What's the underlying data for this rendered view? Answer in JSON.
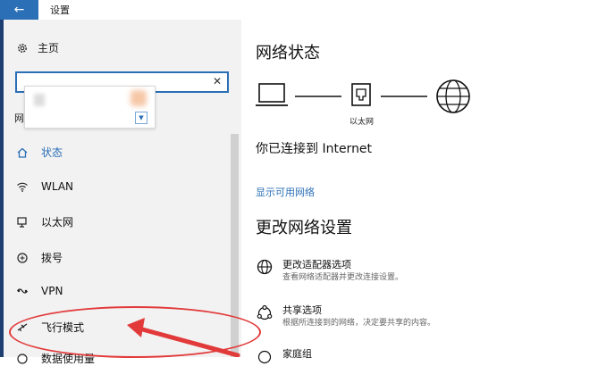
{
  "titlebar": {
    "title": "设置",
    "back_glyph": "←"
  },
  "sidebar": {
    "home_label": "主页",
    "search_value": "",
    "clear_glyph": "✕",
    "cut_label": "网",
    "items": [
      {
        "label": "状态",
        "icon": "home-icon",
        "active": true
      },
      {
        "label": "WLAN",
        "icon": "wifi-icon"
      },
      {
        "label": "以太网",
        "icon": "ethernet-icon"
      },
      {
        "label": "拨号",
        "icon": "dialup-icon"
      },
      {
        "label": "VPN",
        "icon": "vpn-icon"
      },
      {
        "label": "飞行模式",
        "icon": "airplane-icon"
      },
      {
        "label": "数据使用量",
        "icon": "data-usage-icon"
      }
    ]
  },
  "main": {
    "status_heading": "网络状态",
    "ethernet_label": "以太网",
    "connected_text": "你已连接到 Internet",
    "show_networks_link": "显示可用网络",
    "change_heading": "更改网络设置",
    "options": [
      {
        "title": "更改适配器选项",
        "desc": "查看网络适配器并更改连接设置。",
        "icon": "adapter-globe-icon"
      },
      {
        "title": "共享选项",
        "desc": "根据所连接到的网络，决定要共享的内容。",
        "icon": "sharing-icon"
      },
      {
        "title": "家庭组",
        "desc": "",
        "icon": "homegroup-icon"
      }
    ]
  },
  "colors": {
    "accent": "#2b6fb6",
    "annotation": "#e23a3a",
    "sidebar_bg": "#f2f2f2"
  }
}
